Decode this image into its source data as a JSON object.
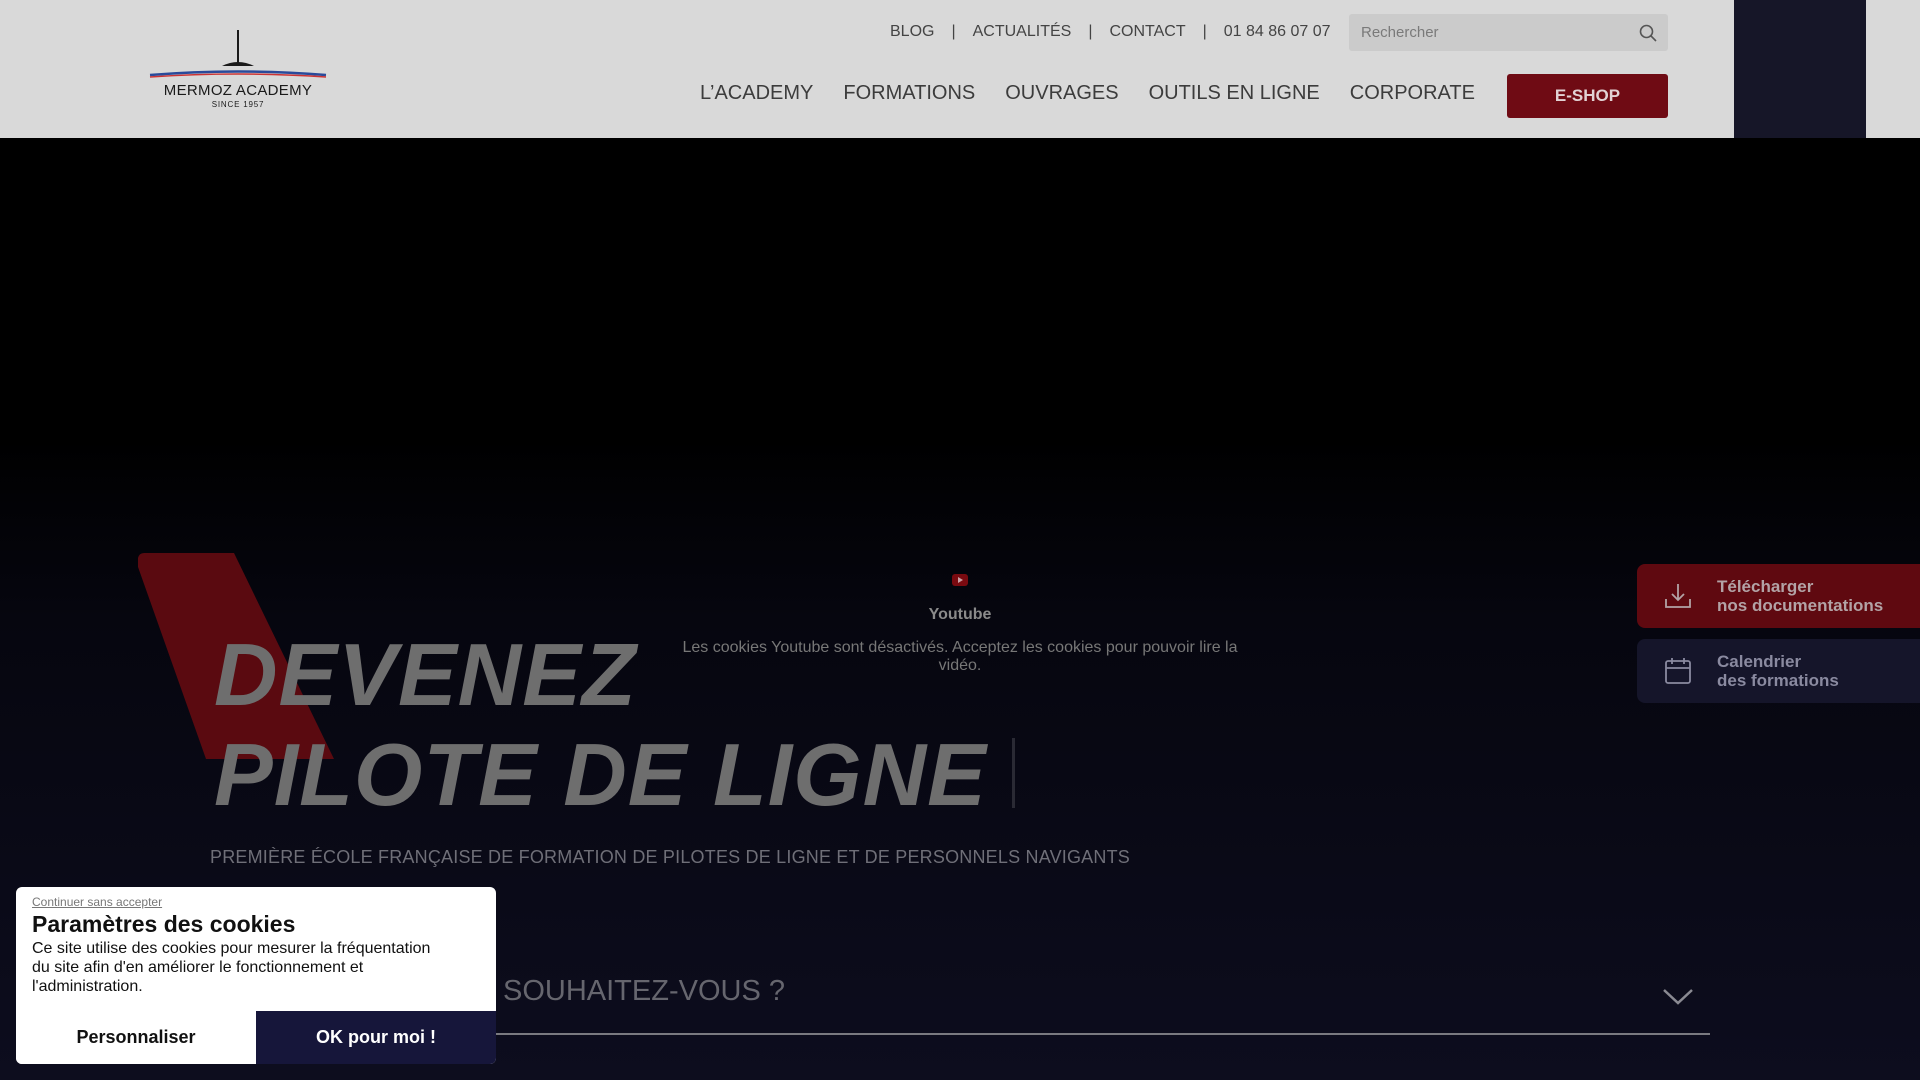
{
  "header": {
    "logo": {
      "name": "MERMOZ ACADEMY",
      "since": "SINCE 1957"
    },
    "topbar": [
      {
        "label": "BLOG"
      },
      {
        "label": "ACTUALITÉS"
      },
      {
        "label": "CONTACT"
      },
      {
        "label": "01 84 86 07 07"
      }
    ],
    "separator": "|",
    "search": {
      "placeholder": "Rechercher"
    },
    "mainnav": [
      {
        "label": "L’ACADEMY"
      },
      {
        "label": "FORMATIONS"
      },
      {
        "label": "OUVRAGES"
      },
      {
        "label": "OUTILS EN LIGNE"
      },
      {
        "label": "CORPORATE"
      }
    ],
    "eshop_label": "E-SHOP"
  },
  "video": {
    "label": "Youtube",
    "message": "Les cookies Youtube sont désactivés. Acceptez les cookies pour pouvoir lire la vidéo."
  },
  "hero": {
    "title_line1": "DEVENEZ",
    "title_line2": "PILOTE DE LIGNE",
    "subtitle": "PREMIÈRE ÉCOLE FRANÇAISE DE FORMATION DE PILOTES DE LIGNE ET DE PERSONNELS NAVIGANTS",
    "dropdown_text": "N SOUHAITEZ-VOUS ?"
  },
  "side": {
    "docs_line1": "Télécharger",
    "docs_line2": "nos documentations",
    "cal_line1": "Calendrier",
    "cal_line2": "des formations"
  },
  "cookie": {
    "skip": "Continuer sans accepter",
    "title": "Paramètres des cookies",
    "text": "Ce site utilise des cookies pour mesurer la fréquentation du site afin d'en améliorer le fonctionnement et l'administration.",
    "customize": "Personnaliser",
    "accept": "OK pour moi !"
  },
  "colors": {
    "brand_red": "#6f0b14",
    "navy": "#16163a",
    "header_bg": "#d9d9d9"
  }
}
